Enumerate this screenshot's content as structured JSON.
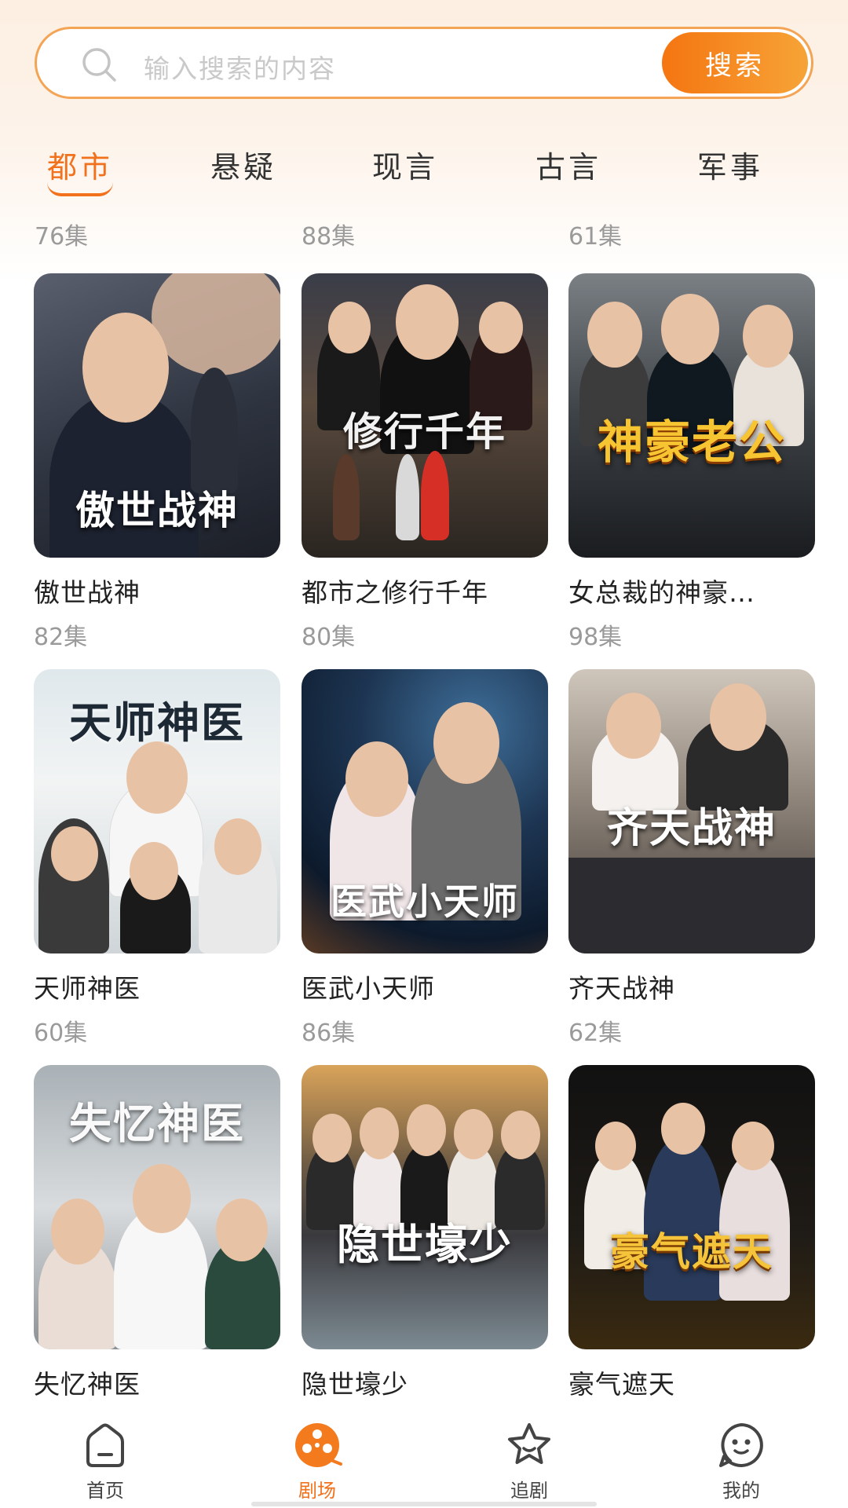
{
  "search": {
    "placeholder": "输入搜索的内容",
    "button_label": "搜索"
  },
  "tabs": [
    {
      "label": "都市",
      "active": true
    },
    {
      "label": "悬疑",
      "active": false
    },
    {
      "label": "现言",
      "active": false
    },
    {
      "label": "古言",
      "active": false
    },
    {
      "label": "军事",
      "active": false
    }
  ],
  "partial_row": [
    "76集",
    "88集",
    "61集"
  ],
  "dramas": [
    {
      "title": "傲世战神",
      "episodes": "82集",
      "poster_text": "傲世战神"
    },
    {
      "title": "都市之修行千年",
      "episodes": "80集",
      "poster_text": "修行千年"
    },
    {
      "title": "女总裁的神豪…",
      "episodes": "98集",
      "poster_text": "神豪老公"
    },
    {
      "title": "天师神医",
      "episodes": "60集",
      "poster_text": "天师神医"
    },
    {
      "title": "医武小天师",
      "episodes": "86集",
      "poster_text": "医武小天师"
    },
    {
      "title": "齐天战神",
      "episodes": "62集",
      "poster_text": "齐天战神"
    },
    {
      "title": "失忆神医",
      "episodes": "",
      "poster_text": "失忆神医"
    },
    {
      "title": "隐世壕少",
      "episodes": "",
      "poster_text": "隐世壕少"
    },
    {
      "title": "豪气遮天",
      "episodes": "",
      "poster_text": "豪气遮天"
    }
  ],
  "nav": [
    {
      "label": "首页",
      "icon": "home-icon",
      "active": false
    },
    {
      "label": "剧场",
      "icon": "film-reel-icon",
      "active": true
    },
    {
      "label": "追剧",
      "icon": "star-icon",
      "active": false
    },
    {
      "label": "我的",
      "icon": "smiley-icon",
      "active": false
    }
  ],
  "colors": {
    "accent": "#f1711c",
    "search_button_start": "#f57511",
    "search_button_end": "#f6a437"
  }
}
